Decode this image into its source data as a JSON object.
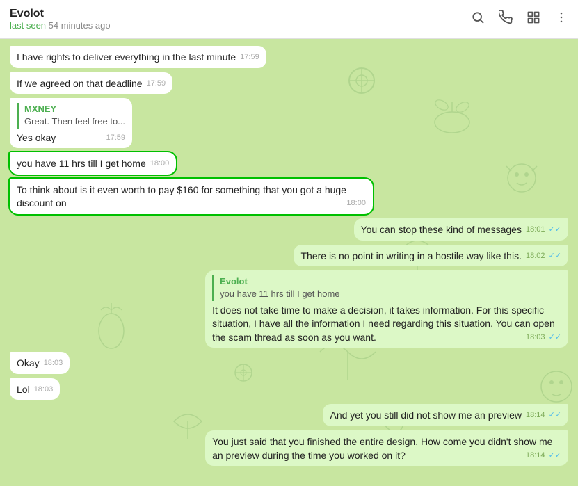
{
  "header": {
    "name": "Evolot",
    "status_prefix": "last seen ",
    "status_time": "54 minutes ago",
    "icons": {
      "search": "🔍",
      "phone": "📞",
      "layout": "⊞",
      "more": "⋮"
    }
  },
  "messages": [
    {
      "id": "msg1",
      "type": "incoming",
      "text": "I have rights to deliver everything in the last minute",
      "time": "17:59",
      "highlighted": false
    },
    {
      "id": "msg2",
      "type": "incoming",
      "text": "If we agreed on that deadline",
      "time": "17:59",
      "highlighted": false
    },
    {
      "id": "msg3",
      "type": "incoming",
      "text": "Yes okay",
      "time": "17:59",
      "quote_author": "MXNEY",
      "quote_text": "Great. Then feel free to...",
      "highlighted": false
    },
    {
      "id": "msg4",
      "type": "incoming",
      "text": "you have 11 hrs till I get home",
      "time": "18:00",
      "highlighted": true
    },
    {
      "id": "msg5",
      "type": "incoming",
      "text": "To think about is it even worth to pay $160 for something that you got a huge discount on",
      "time": "18:00",
      "highlighted": true
    },
    {
      "id": "msg6",
      "type": "outgoing",
      "text": "You can stop these kind of messages",
      "time": "18:01",
      "checks": "✓✓",
      "checks_color": "blue"
    },
    {
      "id": "msg7",
      "type": "outgoing",
      "text": "There is no point in writing in a hostile way like this.",
      "time": "18:02",
      "checks": "✓✓",
      "checks_color": "blue"
    },
    {
      "id": "msg8",
      "type": "outgoing",
      "sender": "Evolot",
      "quote_text": "you have 11 hrs till I get home",
      "text": "It does not take time to make a decision, it takes information. For this specific situation, I have all the information I need regarding this situation. You can open the scam thread as soon as you want.",
      "time": "18:03",
      "checks": "✓✓",
      "checks_color": "blue"
    },
    {
      "id": "msg9",
      "type": "incoming",
      "text": "Okay",
      "time": "18:03",
      "highlighted": false
    },
    {
      "id": "msg10",
      "type": "incoming",
      "text": "Lol",
      "time": "18:03",
      "highlighted": false
    },
    {
      "id": "msg11",
      "type": "outgoing",
      "text": "And yet you still did not show me an preview",
      "time": "18:14",
      "checks": "✓✓",
      "checks_color": "blue"
    },
    {
      "id": "msg12",
      "type": "outgoing",
      "text": "You just said that you finished the entire design. How come you didn't show me an preview during the time you worked on it?",
      "time": "18:14",
      "checks": "✓✓",
      "checks_color": "blue"
    }
  ]
}
